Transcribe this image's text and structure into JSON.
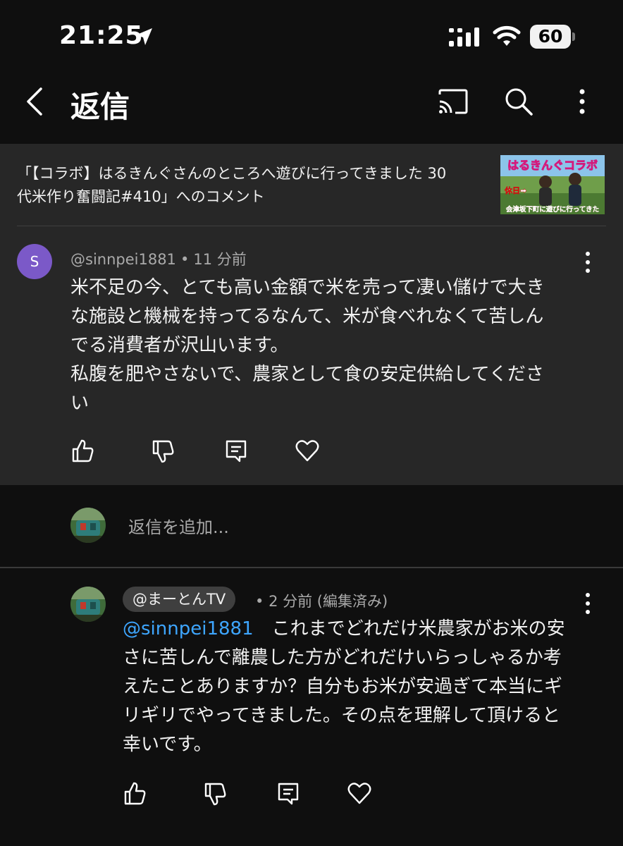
{
  "status_bar": {
    "time": "21:25",
    "battery": "60"
  },
  "header": {
    "title": "返信"
  },
  "context": {
    "video_ref_line1": "「【コラボ】はるきんぐさんのところへ遊びに行ってきました 30",
    "video_ref_line2": "代米作り奮闘記#410」へのコメント",
    "thumbnail": {
      "title_text": "はるきんぐコラボ",
      "tag_text": "休日➡",
      "bottom_text": "会津坂下町に遊びに行ってきた"
    }
  },
  "parent_comment": {
    "avatar_letter": "S",
    "author": "@sinnpei1881",
    "separator": "•",
    "time": "11 分前",
    "lines": [
      "米不足の今、とても高い金額で米を売って凄い儲けで大き",
      "な施設と機械を持ってるなんて、米が食べれなくて苦しん",
      "でる消費者が沢山います。",
      "私腹を肥やさないで、農家として食の安定供給してくださ",
      "い"
    ]
  },
  "composer": {
    "placeholder": "返信を追加..."
  },
  "reply": {
    "author": "@まーとんTV",
    "separator": "•",
    "meta": "2 分前 (編集済み)",
    "mention": "@sinnpei1881",
    "line1_rest": "これまでどれだけ米農家がお米の安",
    "lines": [
      "さに苦しんで離農した方がどれだけいらっしゃるか考",
      "えたことありますか？自分もお米が安過ぎて本当にギ",
      "リギリでやってきました。その点を理解して頂けると",
      "幸いです。"
    ]
  },
  "icons": [
    "location-arrow-icon",
    "signal-icon",
    "wifi-icon",
    "battery-icon",
    "back-icon",
    "cast-icon",
    "search-icon",
    "more-vert-icon",
    "thumbs-up-icon",
    "thumbs-down-icon",
    "reply-icon",
    "heart-icon"
  ],
  "colors": {
    "background": "#0f0f0f",
    "panel": "#272727",
    "mention": "#3ea6ff",
    "avatar_s": "#7b59c8",
    "secondary_text": "#aaaaaa"
  }
}
